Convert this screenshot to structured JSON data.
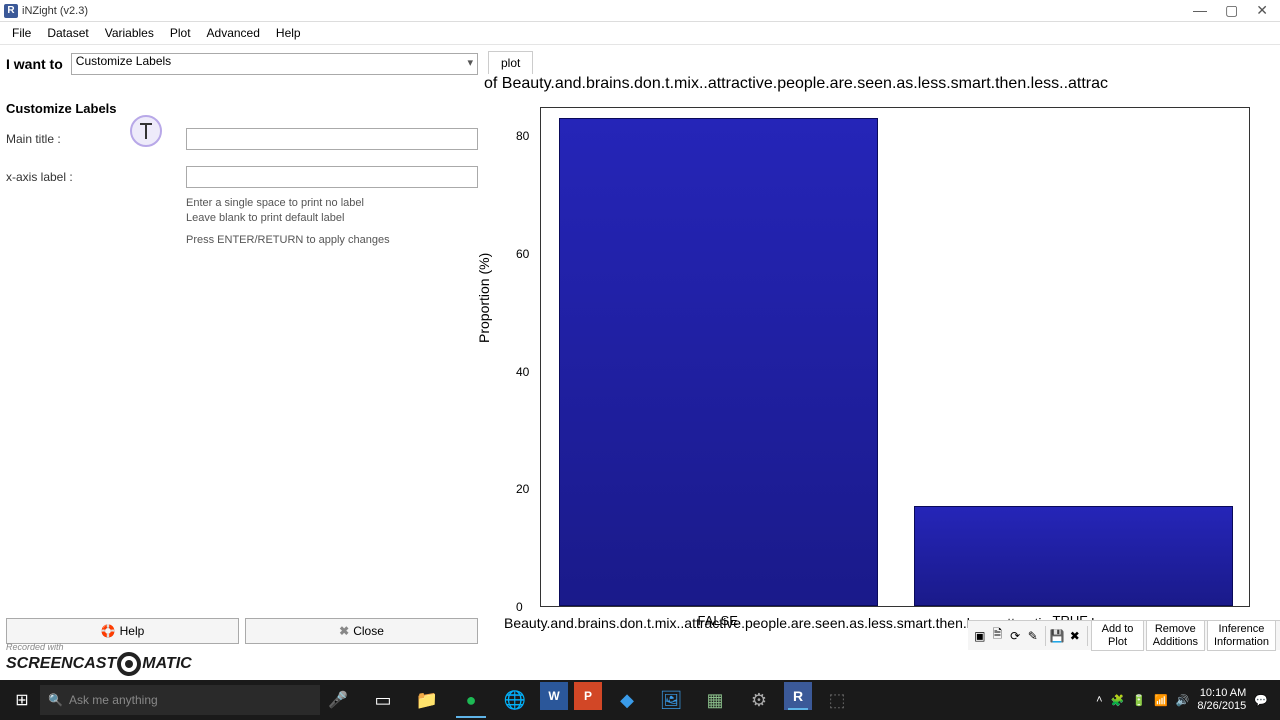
{
  "window": {
    "title": "iNZight (v2.3)",
    "icon_letter": "R"
  },
  "menu": [
    "File",
    "Dataset",
    "Variables",
    "Plot",
    "Advanced",
    "Help"
  ],
  "iwant": {
    "label": "I want to",
    "selected": "Customize Labels"
  },
  "section_header": "Customize Labels",
  "form": {
    "main_title_label": "Main title :",
    "main_title_value": "",
    "xaxis_label": "x-axis label :",
    "xaxis_value": "",
    "hint1": "Enter a single space to print no label",
    "hint2": "Leave blank to print default label",
    "hint3": "Press ENTER/RETURN to apply changes"
  },
  "buttons": {
    "help": "Help",
    "close": "Close"
  },
  "plot": {
    "tab": "plot",
    "title": "of Beauty.and.brains.don.t.mix..attractive.people.are.seen.as.less.smart.then.less..attrac",
    "ylabel": "Proportion (%)",
    "xlabel": "Beauty.and.brains.don.t.mix..attractive.people.are.seen.as.less.smart.then.less..attractive.people.."
  },
  "chart_data": {
    "type": "bar",
    "categories": [
      "FALSE",
      "TRUE"
    ],
    "values": [
      83,
      17
    ],
    "ylabel": "Proportion (%)",
    "xlabel": "Beauty.and.brains.don.t.mix..attractive.people.are.seen.as.less.smart.then.less..attractive.people..",
    "title": "of Beauty.and.brains.don.t.mix..attractive.people.are.seen.as.less.smart.then.less..attrac",
    "yticks": [
      0,
      20,
      40,
      60,
      80
    ],
    "ylim": [
      0,
      85
    ]
  },
  "bottom_tools": {
    "add_to_plot": "Add to Plot",
    "remove_additions": "Remove\nAdditions",
    "inference_info": "Inference\nInformation"
  },
  "taskbar": {
    "search_placeholder": "Ask me anything",
    "time": "10:10 AM",
    "date": "8/26/2015"
  }
}
